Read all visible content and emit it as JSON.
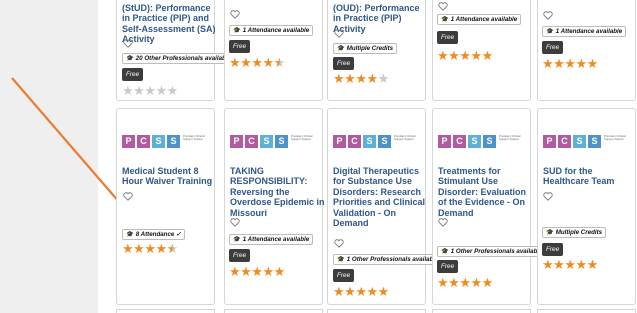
{
  "provider_logo": {
    "letters": [
      "P",
      "C",
      "S",
      "S"
    ],
    "colors": [
      "#b05aa2",
      "#b05aa2",
      "#5fb0d6",
      "#4f91c9"
    ],
    "desc": "Providers Clinical Support System"
  },
  "colors": {
    "title": "#30578a",
    "star_filled": "#f08b1d",
    "star_empty": "#c9c9c9",
    "free_badge": "#3c3c3c",
    "arrow": "#ec7b31"
  },
  "top_row": [
    {
      "title": "(StUD): Performance in Practice (PIP) and Self-Assessment (SA) Activity",
      "pill": "20 Other Professionals available",
      "free": "Free",
      "stars": "★★★★★",
      "rating": 0
    },
    {
      "pill": "1 Attendance available",
      "free": "Free",
      "stars": "★★★★★",
      "rating": 4.5
    },
    {
      "title": "(OUD): Performance in Practice (PIP) Activity",
      "pill": "Multiple Credits",
      "free": "Free",
      "stars": "★★★★★",
      "rating": 4
    },
    {
      "pill": "1 Attendance available",
      "free": "Free",
      "stars": "★★★★★",
      "rating": 5
    },
    {
      "pill": "1 Attendance available",
      "free": "Free",
      "stars": "★★★★★",
      "rating": 5
    }
  ],
  "bottom_row": [
    {
      "title": "Medical Student 8 Hour Waiver Training",
      "pill": "8 Attendance ✓",
      "stars": "★★★★★",
      "rating": 4.5
    },
    {
      "title": "TAKING RESPONSIBILITY: Reversing the Overdose Epidemic in Missouri",
      "pill": "1 Attendance available",
      "free": "Free",
      "stars": "★★★★★",
      "rating": 5
    },
    {
      "title": "Digital Therapeutics for Substance Use Disorders: Research Priorities and Clinical Validation - On Demand",
      "pill": "1 Other Professionals available",
      "free": "Free",
      "stars": "★★★★★",
      "rating": 5
    },
    {
      "title": "Treatments for Stimulant Use Disorder: Evaluation of the Evidence - On Demand",
      "pill": "1 Other Professionals available",
      "free": "Free",
      "stars": "★★★★★",
      "rating": 5
    },
    {
      "title": "SUD for the Healthcare Team",
      "pill": "Multiple Credits",
      "free": "Free",
      "stars": "★★★★★",
      "rating": 5
    }
  ]
}
